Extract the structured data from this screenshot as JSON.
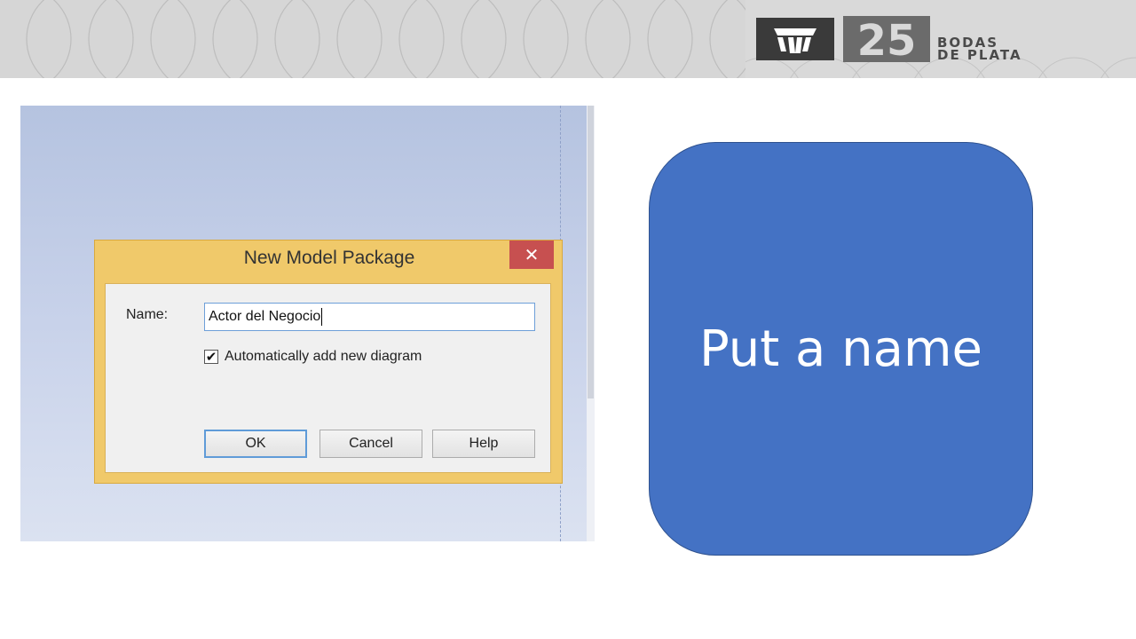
{
  "banner": {
    "logo_line1": "BODAS",
    "logo_line2": "DE PLATA",
    "logo_number": "25"
  },
  "dialog": {
    "title": "New Model Package",
    "close_glyph": "✕",
    "name_label": "Name:",
    "name_value": "Actor del Negocio",
    "checkbox_checked": true,
    "checkbox_glyph": "✔",
    "checkbox_label": "Automatically add new diagram",
    "buttons": {
      "ok": "OK",
      "cancel": "Cancel",
      "help": "Help"
    }
  },
  "callout": {
    "text": "Put a name"
  },
  "colors": {
    "callout_fill": "#4472c4",
    "dialog_frame": "#f0c96a",
    "close_button": "#c75050",
    "banner_bg": "#d6d6d6"
  }
}
